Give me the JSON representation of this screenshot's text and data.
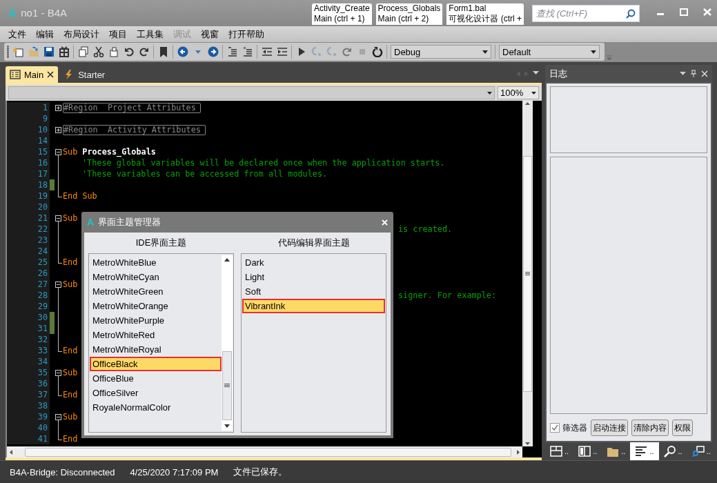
{
  "window": {
    "logo": "A",
    "title": "no1 - B4A"
  },
  "quick_tabs": [
    {
      "title": "Activity_Create",
      "subtitle": "Main  (ctrl + 1)"
    },
    {
      "title": "Process_Globals",
      "subtitle": "Main  (ctrl + 2)"
    },
    {
      "title": "Form1.bal",
      "subtitle": "可视化设计器  (ctrl +"
    }
  ],
  "search": {
    "placeholder": "查找 (Ctrl+F)"
  },
  "menu": [
    {
      "label": "文件",
      "disabled": false
    },
    {
      "label": "编辑",
      "disabled": false
    },
    {
      "label": "布局设计",
      "disabled": false
    },
    {
      "label": "项目",
      "disabled": false
    },
    {
      "label": "工具集",
      "disabled": false
    },
    {
      "label": "调试",
      "disabled": true
    },
    {
      "label": "视窗",
      "disabled": false
    },
    {
      "label": "打开帮助",
      "disabled": false
    }
  ],
  "toolbar": {
    "items": [
      {
        "kind": "new",
        "disabled": false
      },
      {
        "kind": "open",
        "disabled": false
      },
      {
        "kind": "save",
        "disabled": false
      },
      {
        "kind": "library",
        "disabled": false
      },
      {
        "kind": "sep"
      },
      {
        "kind": "copy",
        "disabled": false
      },
      {
        "kind": "cut",
        "disabled": false
      },
      {
        "kind": "paste",
        "disabled": false
      },
      {
        "kind": "undo",
        "disabled": false
      },
      {
        "kind": "redo",
        "disabled": false
      },
      {
        "kind": "sep"
      },
      {
        "kind": "bookmark",
        "disabled": false
      },
      {
        "kind": "sep"
      },
      {
        "kind": "back",
        "disabled": false
      },
      {
        "kind": "caret",
        "disabled": false
      },
      {
        "kind": "forward",
        "disabled": false
      },
      {
        "kind": "sep"
      },
      {
        "kind": "comment",
        "disabled": false
      },
      {
        "kind": "uncomment",
        "disabled": false
      },
      {
        "kind": "sep"
      },
      {
        "kind": "outdent",
        "disabled": false
      },
      {
        "kind": "indent",
        "disabled": false
      },
      {
        "kind": "sep"
      },
      {
        "kind": "run",
        "disabled": false
      },
      {
        "kind": "step",
        "disabled": true
      },
      {
        "kind": "step",
        "disabled": true
      },
      {
        "kind": "redo",
        "disabled": true
      },
      {
        "kind": "stop",
        "disabled": true
      },
      {
        "kind": "restart",
        "disabled": false
      }
    ],
    "build_config": "Debug",
    "theme_combo": "Default"
  },
  "doc_tabs": [
    {
      "label": "Main",
      "kind": "module",
      "selected": true
    },
    {
      "label": "Starter",
      "kind": "service",
      "selected": false
    }
  ],
  "zoom": "100%",
  "code_lines": [
    {
      "number": "1",
      "kind": "expand",
      "modified": false,
      "tokens": [
        {
          "kind": "region",
          "text": "#Region  Project Attributes"
        }
      ]
    },
    {
      "number": "9",
      "kind": "plain",
      "modified": false
    },
    {
      "number": "10",
      "kind": "expand",
      "modified": false,
      "tokens": [
        {
          "kind": "region",
          "text": "#Region  Activity Attributes"
        }
      ]
    },
    {
      "number": "14",
      "kind": "plain",
      "modified": false
    },
    {
      "number": "15",
      "kind": "collapse",
      "modified": false,
      "tokens": [
        {
          "kind": "keyword",
          "text": "Sub"
        },
        {
          "kind": "name",
          "text": "Process_Globals"
        }
      ]
    },
    {
      "number": "16",
      "kind": "guide",
      "modified": false,
      "tokens": [
        {
          "kind": "comment",
          "text": "'These global variables will be declared once when the application starts."
        }
      ]
    },
    {
      "number": "17",
      "kind": "guide",
      "modified": false,
      "tokens": [
        {
          "kind": "comment",
          "text": "'These variables can be accessed from all modules."
        }
      ]
    },
    {
      "number": "18",
      "kind": "guide",
      "modified": true
    },
    {
      "number": "19",
      "kind": "end",
      "modified": false,
      "tokens": [
        {
          "kind": "keyword",
          "text": "End Sub"
        }
      ]
    },
    {
      "number": "20",
      "kind": "plain",
      "modified": false
    },
    {
      "number": "21",
      "kind": "collapse",
      "modified": false,
      "tokens": [
        {
          "kind": "keyword",
          "text": "Sub"
        }
      ]
    },
    {
      "number": "22",
      "kind": "guide",
      "modified": false,
      "tail": "is created."
    },
    {
      "number": "23",
      "kind": "guide",
      "modified": false
    },
    {
      "number": "24",
      "kind": "guide",
      "modified": false
    },
    {
      "number": "25",
      "kind": "end",
      "modified": false,
      "tokens": [
        {
          "kind": "keyword",
          "text": "End"
        }
      ]
    },
    {
      "number": "26",
      "kind": "plain",
      "modified": false
    },
    {
      "number": "27",
      "kind": "collapse",
      "modified": false,
      "tokens": [
        {
          "kind": "keyword",
          "text": "Sub"
        }
      ]
    },
    {
      "number": "28",
      "kind": "guide",
      "modified": false,
      "tail": "signer. For example:"
    },
    {
      "number": "29",
      "kind": "guide",
      "modified": false
    },
    {
      "number": "30",
      "kind": "guide",
      "modified": true
    },
    {
      "number": "31",
      "kind": "guide",
      "modified": true
    },
    {
      "number": "32",
      "kind": "guide",
      "modified": false
    },
    {
      "number": "33",
      "kind": "end",
      "modified": false,
      "tokens": [
        {
          "kind": "keyword",
          "text": "End"
        }
      ]
    },
    {
      "number": "34",
      "kind": "plain",
      "modified": false
    },
    {
      "number": "35",
      "kind": "collapse",
      "modified": false,
      "tokens": [
        {
          "kind": "keyword",
          "text": "Sub"
        }
      ]
    },
    {
      "number": "36",
      "kind": "guide",
      "modified": false
    },
    {
      "number": "37",
      "kind": "end",
      "modified": false,
      "tokens": [
        {
          "kind": "keyword",
          "text": "End"
        }
      ]
    },
    {
      "number": "38",
      "kind": "plain",
      "modified": false
    },
    {
      "number": "39",
      "kind": "collapse",
      "modified": false,
      "tokens": [
        {
          "kind": "keyword",
          "text": "Sub"
        }
      ]
    },
    {
      "number": "40",
      "kind": "guide",
      "modified": false
    },
    {
      "number": "41",
      "kind": "end",
      "modified": false,
      "tokens": [
        {
          "kind": "keyword",
          "text": "End"
        }
      ]
    }
  ],
  "dialog": {
    "logo": "A",
    "title": "界面主题管理器",
    "columns": [
      {
        "heading": "IDE界面主题",
        "scrollbar": true,
        "items": [
          {
            "label": "MetroWhiteBlue",
            "selected": false
          },
          {
            "label": "MetroWhiteCyan",
            "selected": false
          },
          {
            "label": "MetroWhiteGreen",
            "selected": false
          },
          {
            "label": "MetroWhiteOrange",
            "selected": false
          },
          {
            "label": "MetroWhitePurple",
            "selected": false
          },
          {
            "label": "MetroWhiteRed",
            "selected": false
          },
          {
            "label": "MetroWhiteRoyal",
            "selected": false
          },
          {
            "label": "OfficeBlack",
            "selected": true
          },
          {
            "label": "OfficeBlue",
            "selected": false
          },
          {
            "label": "OfficeSilver",
            "selected": false
          },
          {
            "label": "RoyaleNormalColor",
            "selected": false
          }
        ]
      },
      {
        "heading": "代码编辑界面主题",
        "scrollbar": false,
        "items": [
          {
            "label": "Dark",
            "selected": false
          },
          {
            "label": "Light",
            "selected": false
          },
          {
            "label": "Soft",
            "selected": false
          },
          {
            "label": "VibrantInk",
            "selected": true
          }
        ]
      }
    ]
  },
  "log_panel": {
    "title": "日志",
    "filter": {
      "label": "筛选器",
      "checked": true
    },
    "buttons": [
      "启动连接",
      "清除内容",
      "权限"
    ],
    "bottom_tabs": [
      {
        "kind": "layout",
        "label": "..",
        "selected": false
      },
      {
        "kind": "book",
        "label": "..",
        "selected": false
      },
      {
        "kind": "folder",
        "label": "..",
        "selected": false
      },
      {
        "kind": "lines",
        "label": "..",
        "selected": true
      },
      {
        "kind": "search",
        "label": "..",
        "selected": false
      },
      {
        "kind": "find",
        "label": "..",
        "selected": false
      }
    ]
  },
  "status_bar": [
    "B4A-Bridge: Disconnected",
    "4/25/2020 7:17:09 PM",
    "文件已保存。"
  ]
}
